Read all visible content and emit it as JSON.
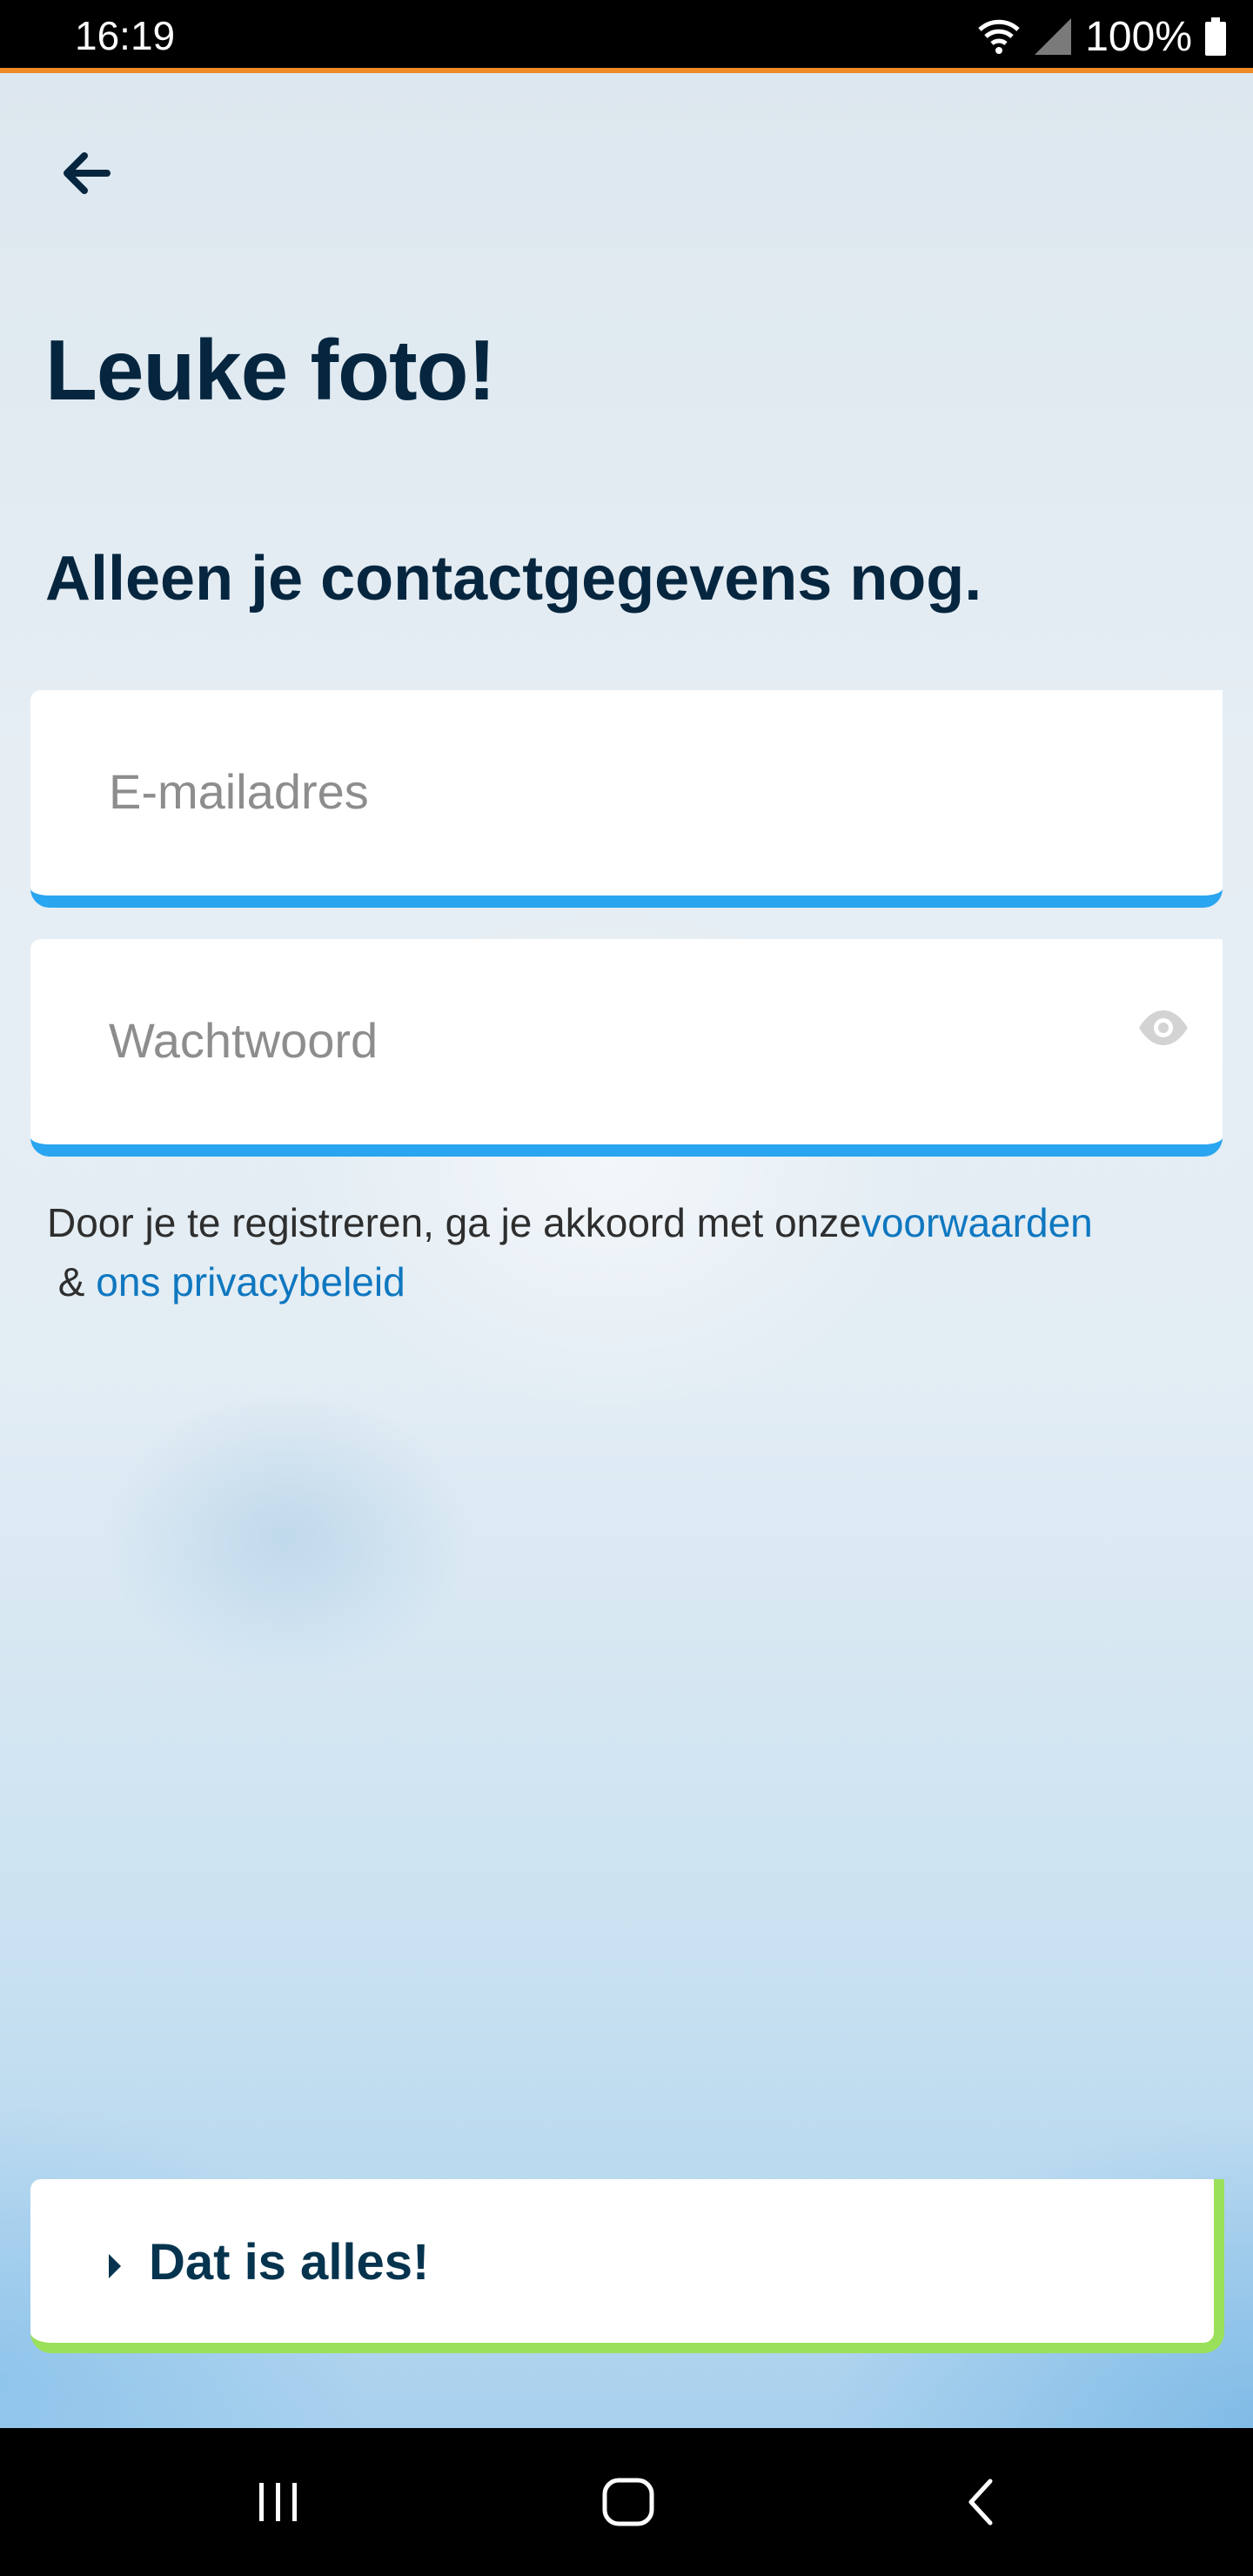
{
  "status_bar": {
    "time": "16:19",
    "battery": "100%",
    "icons": [
      "wifi-icon",
      "signal-icon",
      "battery-icon"
    ]
  },
  "header": {
    "back_icon": "arrow-left-icon"
  },
  "main": {
    "title": "Leuke foto!",
    "subtitle": "Alleen je contactgegevens nog.",
    "email_field": {
      "placeholder": "E-mailadres",
      "value": ""
    },
    "password_field": {
      "placeholder": "Wachtwoord",
      "value": "",
      "toggle_icon": "eye-icon"
    },
    "terms": {
      "prefix": "Door je te registreren, ga je akkoord met onze",
      "terms_link": "voorwaarden",
      "separator": " & ",
      "privacy_link": "ons privacybeleid"
    },
    "submit": {
      "label": "Dat is alles!",
      "icon": "caret-right-icon"
    }
  },
  "colors": {
    "accent_blue": "#2aa5f0",
    "submit_green": "#9be05a",
    "title_navy": "#06263f",
    "link_blue": "#0f77c0",
    "status_orange": "#f08a24"
  },
  "nav_bar": {
    "buttons": [
      "recent-apps-icon",
      "home-icon",
      "back-icon"
    ]
  }
}
